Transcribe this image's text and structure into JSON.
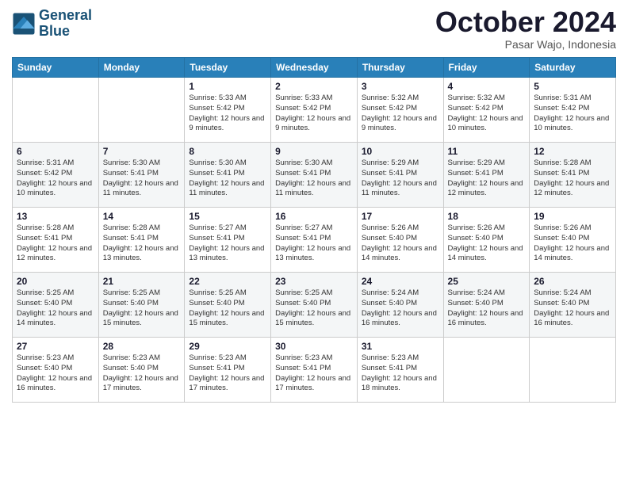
{
  "logo": {
    "line1": "General",
    "line2": "Blue"
  },
  "title": "October 2024",
  "location": "Pasar Wajo, Indonesia",
  "days_of_week": [
    "Sunday",
    "Monday",
    "Tuesday",
    "Wednesday",
    "Thursday",
    "Friday",
    "Saturday"
  ],
  "weeks": [
    [
      {
        "day": "",
        "sunrise": "",
        "sunset": "",
        "daylight": ""
      },
      {
        "day": "",
        "sunrise": "",
        "sunset": "",
        "daylight": ""
      },
      {
        "day": "1",
        "sunrise": "Sunrise: 5:33 AM",
        "sunset": "Sunset: 5:42 PM",
        "daylight": "Daylight: 12 hours and 9 minutes."
      },
      {
        "day": "2",
        "sunrise": "Sunrise: 5:33 AM",
        "sunset": "Sunset: 5:42 PM",
        "daylight": "Daylight: 12 hours and 9 minutes."
      },
      {
        "day": "3",
        "sunrise": "Sunrise: 5:32 AM",
        "sunset": "Sunset: 5:42 PM",
        "daylight": "Daylight: 12 hours and 9 minutes."
      },
      {
        "day": "4",
        "sunrise": "Sunrise: 5:32 AM",
        "sunset": "Sunset: 5:42 PM",
        "daylight": "Daylight: 12 hours and 10 minutes."
      },
      {
        "day": "5",
        "sunrise": "Sunrise: 5:31 AM",
        "sunset": "Sunset: 5:42 PM",
        "daylight": "Daylight: 12 hours and 10 minutes."
      }
    ],
    [
      {
        "day": "6",
        "sunrise": "Sunrise: 5:31 AM",
        "sunset": "Sunset: 5:42 PM",
        "daylight": "Daylight: 12 hours and 10 minutes."
      },
      {
        "day": "7",
        "sunrise": "Sunrise: 5:30 AM",
        "sunset": "Sunset: 5:41 PM",
        "daylight": "Daylight: 12 hours and 11 minutes."
      },
      {
        "day": "8",
        "sunrise": "Sunrise: 5:30 AM",
        "sunset": "Sunset: 5:41 PM",
        "daylight": "Daylight: 12 hours and 11 minutes."
      },
      {
        "day": "9",
        "sunrise": "Sunrise: 5:30 AM",
        "sunset": "Sunset: 5:41 PM",
        "daylight": "Daylight: 12 hours and 11 minutes."
      },
      {
        "day": "10",
        "sunrise": "Sunrise: 5:29 AM",
        "sunset": "Sunset: 5:41 PM",
        "daylight": "Daylight: 12 hours and 11 minutes."
      },
      {
        "day": "11",
        "sunrise": "Sunrise: 5:29 AM",
        "sunset": "Sunset: 5:41 PM",
        "daylight": "Daylight: 12 hours and 12 minutes."
      },
      {
        "day": "12",
        "sunrise": "Sunrise: 5:28 AM",
        "sunset": "Sunset: 5:41 PM",
        "daylight": "Daylight: 12 hours and 12 minutes."
      }
    ],
    [
      {
        "day": "13",
        "sunrise": "Sunrise: 5:28 AM",
        "sunset": "Sunset: 5:41 PM",
        "daylight": "Daylight: 12 hours and 12 minutes."
      },
      {
        "day": "14",
        "sunrise": "Sunrise: 5:28 AM",
        "sunset": "Sunset: 5:41 PM",
        "daylight": "Daylight: 12 hours and 13 minutes."
      },
      {
        "day": "15",
        "sunrise": "Sunrise: 5:27 AM",
        "sunset": "Sunset: 5:41 PM",
        "daylight": "Daylight: 12 hours and 13 minutes."
      },
      {
        "day": "16",
        "sunrise": "Sunrise: 5:27 AM",
        "sunset": "Sunset: 5:41 PM",
        "daylight": "Daylight: 12 hours and 13 minutes."
      },
      {
        "day": "17",
        "sunrise": "Sunrise: 5:26 AM",
        "sunset": "Sunset: 5:40 PM",
        "daylight": "Daylight: 12 hours and 14 minutes."
      },
      {
        "day": "18",
        "sunrise": "Sunrise: 5:26 AM",
        "sunset": "Sunset: 5:40 PM",
        "daylight": "Daylight: 12 hours and 14 minutes."
      },
      {
        "day": "19",
        "sunrise": "Sunrise: 5:26 AM",
        "sunset": "Sunset: 5:40 PM",
        "daylight": "Daylight: 12 hours and 14 minutes."
      }
    ],
    [
      {
        "day": "20",
        "sunrise": "Sunrise: 5:25 AM",
        "sunset": "Sunset: 5:40 PM",
        "daylight": "Daylight: 12 hours and 14 minutes."
      },
      {
        "day": "21",
        "sunrise": "Sunrise: 5:25 AM",
        "sunset": "Sunset: 5:40 PM",
        "daylight": "Daylight: 12 hours and 15 minutes."
      },
      {
        "day": "22",
        "sunrise": "Sunrise: 5:25 AM",
        "sunset": "Sunset: 5:40 PM",
        "daylight": "Daylight: 12 hours and 15 minutes."
      },
      {
        "day": "23",
        "sunrise": "Sunrise: 5:25 AM",
        "sunset": "Sunset: 5:40 PM",
        "daylight": "Daylight: 12 hours and 15 minutes."
      },
      {
        "day": "24",
        "sunrise": "Sunrise: 5:24 AM",
        "sunset": "Sunset: 5:40 PM",
        "daylight": "Daylight: 12 hours and 16 minutes."
      },
      {
        "day": "25",
        "sunrise": "Sunrise: 5:24 AM",
        "sunset": "Sunset: 5:40 PM",
        "daylight": "Daylight: 12 hours and 16 minutes."
      },
      {
        "day": "26",
        "sunrise": "Sunrise: 5:24 AM",
        "sunset": "Sunset: 5:40 PM",
        "daylight": "Daylight: 12 hours and 16 minutes."
      }
    ],
    [
      {
        "day": "27",
        "sunrise": "Sunrise: 5:23 AM",
        "sunset": "Sunset: 5:40 PM",
        "daylight": "Daylight: 12 hours and 16 minutes."
      },
      {
        "day": "28",
        "sunrise": "Sunrise: 5:23 AM",
        "sunset": "Sunset: 5:40 PM",
        "daylight": "Daylight: 12 hours and 17 minutes."
      },
      {
        "day": "29",
        "sunrise": "Sunrise: 5:23 AM",
        "sunset": "Sunset: 5:41 PM",
        "daylight": "Daylight: 12 hours and 17 minutes."
      },
      {
        "day": "30",
        "sunrise": "Sunrise: 5:23 AM",
        "sunset": "Sunset: 5:41 PM",
        "daylight": "Daylight: 12 hours and 17 minutes."
      },
      {
        "day": "31",
        "sunrise": "Sunrise: 5:23 AM",
        "sunset": "Sunset: 5:41 PM",
        "daylight": "Daylight: 12 hours and 18 minutes."
      },
      {
        "day": "",
        "sunrise": "",
        "sunset": "",
        "daylight": ""
      },
      {
        "day": "",
        "sunrise": "",
        "sunset": "",
        "daylight": ""
      }
    ]
  ]
}
